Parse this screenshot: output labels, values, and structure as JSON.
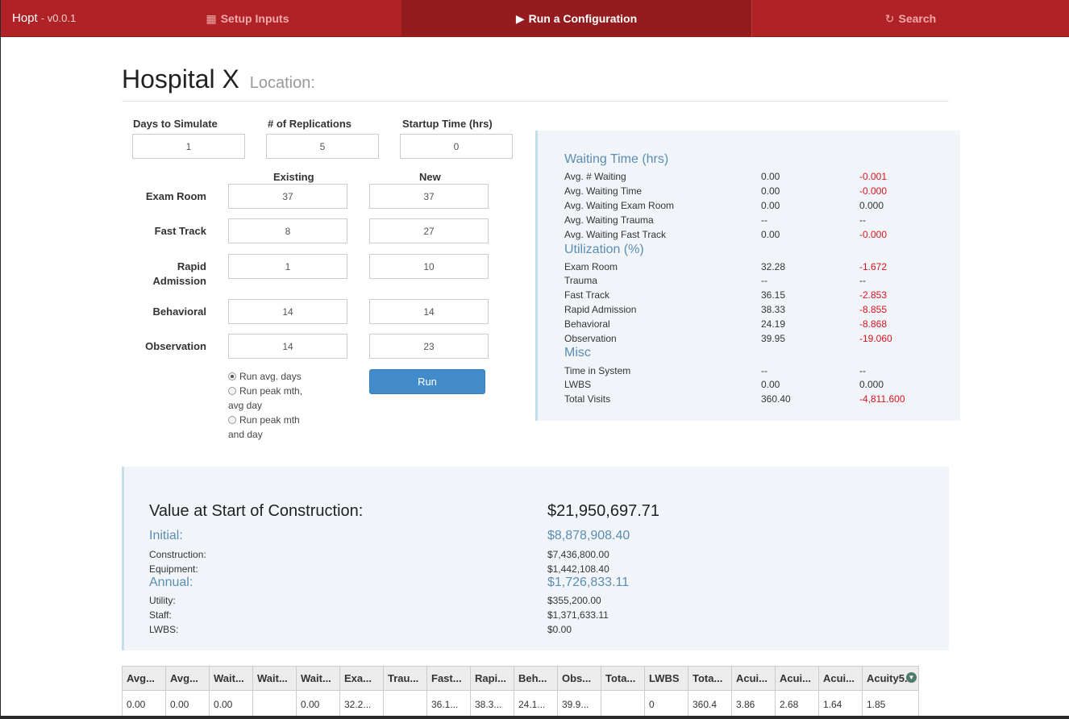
{
  "nav": {
    "brand": "Hopt",
    "version": "- v0.0.1",
    "tabs": [
      {
        "icon": "▦",
        "label": "Setup Inputs"
      },
      {
        "icon": "▶",
        "label": "Run a Configuration"
      },
      {
        "icon": "↻",
        "label": "Search"
      }
    ]
  },
  "header": {
    "title": "Hospital X",
    "subtitle": "Location:"
  },
  "params": {
    "days_label": "Days to Simulate",
    "days_value": "1",
    "reps_label": "# of Replications",
    "reps_value": "5",
    "startup_label": "Startup Time (hrs)",
    "startup_value": "0"
  },
  "rooms": {
    "existing_label": "Existing",
    "new_label": "New",
    "rows": [
      {
        "label": "Exam Room",
        "existing": "37",
        "new": "37"
      },
      {
        "label": "Fast Track",
        "existing": "8",
        "new": "27"
      },
      {
        "label": "Rapid\nAdmission",
        "existing": "1",
        "new": "10"
      },
      {
        "label": "Behavioral",
        "existing": "14",
        "new": "14"
      },
      {
        "label": "Observation",
        "existing": "14",
        "new": "23"
      }
    ]
  },
  "run_options": {
    "opt1": "Run avg. days",
    "opt2a": "Run peak mth,",
    "opt2b": "avg day",
    "opt3a": "Run peak mth",
    "opt3b": "and day",
    "run_label": "Run"
  },
  "stats": {
    "waiting_title": "Waiting Time (hrs)",
    "waiting": [
      {
        "label": "Avg. # Waiting",
        "value": "0.00",
        "delta": "-0.001"
      },
      {
        "label": "Avg. Waiting Time",
        "value": "0.00",
        "delta": "-0.000"
      },
      {
        "label": "Avg. Waiting Exam Room",
        "value": "0.00",
        "delta": "0.000"
      },
      {
        "label": "Avg. Waiting Trauma",
        "value": "--",
        "delta": "--"
      },
      {
        "label": "Avg. Waiting Fast Track",
        "value": "0.00",
        "delta": "-0.000"
      }
    ],
    "util_title": "Utilization (%)",
    "util": [
      {
        "label": "Exam Room",
        "value": "32.28",
        "delta": "-1.672"
      },
      {
        "label": "Trauma",
        "value": "--",
        "delta": "--"
      },
      {
        "label": "Fast Track",
        "value": "36.15",
        "delta": "-2.853"
      },
      {
        "label": "Rapid Admission",
        "value": "38.33",
        "delta": "-8.855"
      },
      {
        "label": "Behavioral",
        "value": "24.19",
        "delta": "-8.868"
      },
      {
        "label": "Observation",
        "value": "39.95",
        "delta": "-19.060"
      }
    ],
    "misc_title": "Misc",
    "misc": [
      {
        "label": "Time in System",
        "value": "--",
        "delta": "--"
      },
      {
        "label": "LWBS",
        "value": "0.00",
        "delta": "0.000"
      },
      {
        "label": "Total Visits",
        "value": "360.40",
        "delta": "-4,811.600"
      }
    ]
  },
  "costs": {
    "value_label": "Value at Start of Construction:",
    "value": "$21,950,697.71",
    "initial_label": "Initial:",
    "initial": "$8,878,908.40",
    "construction_label": "Construction:",
    "construction": "$7,436,800.00",
    "equipment_label": "Equipment:",
    "equipment": "$1,442,108.40",
    "annual_label": "Annual:",
    "annual": "$1,726,833.11",
    "utility_label": "Utility:",
    "utility": "$355,200.00",
    "staff_label": "Staff:",
    "staff": "$1,371,633.11",
    "lwbs_label": "LWBS:",
    "lwbs": "$0.00"
  },
  "grid": {
    "headers": [
      "Avg...",
      "Avg...",
      "Wait...",
      "Wait...",
      "Wait...",
      "Exa...",
      "Trau...",
      "Fast...",
      "Rapi...",
      "Beh...",
      "Obs...",
      "Tota...",
      "LWBS",
      "Tota...",
      "Acui...",
      "Acui...",
      "Acui...",
      "Acuity5..."
    ],
    "row": [
      "0.00",
      "0.00",
      "0.00",
      "",
      "0.00",
      "32.2...",
      "",
      "36.1...",
      "38.3...",
      "24.1...",
      "39.9...",
      "",
      "0",
      "360.4",
      "3.86",
      "2.68",
      "1.64",
      "1.85"
    ]
  },
  "colors": {
    "navbar": "#b02226",
    "nav_active": "#941b1e",
    "accent_blue": "#5a8db1",
    "negative_red": "#d8141e",
    "button_blue": "#428bca"
  }
}
